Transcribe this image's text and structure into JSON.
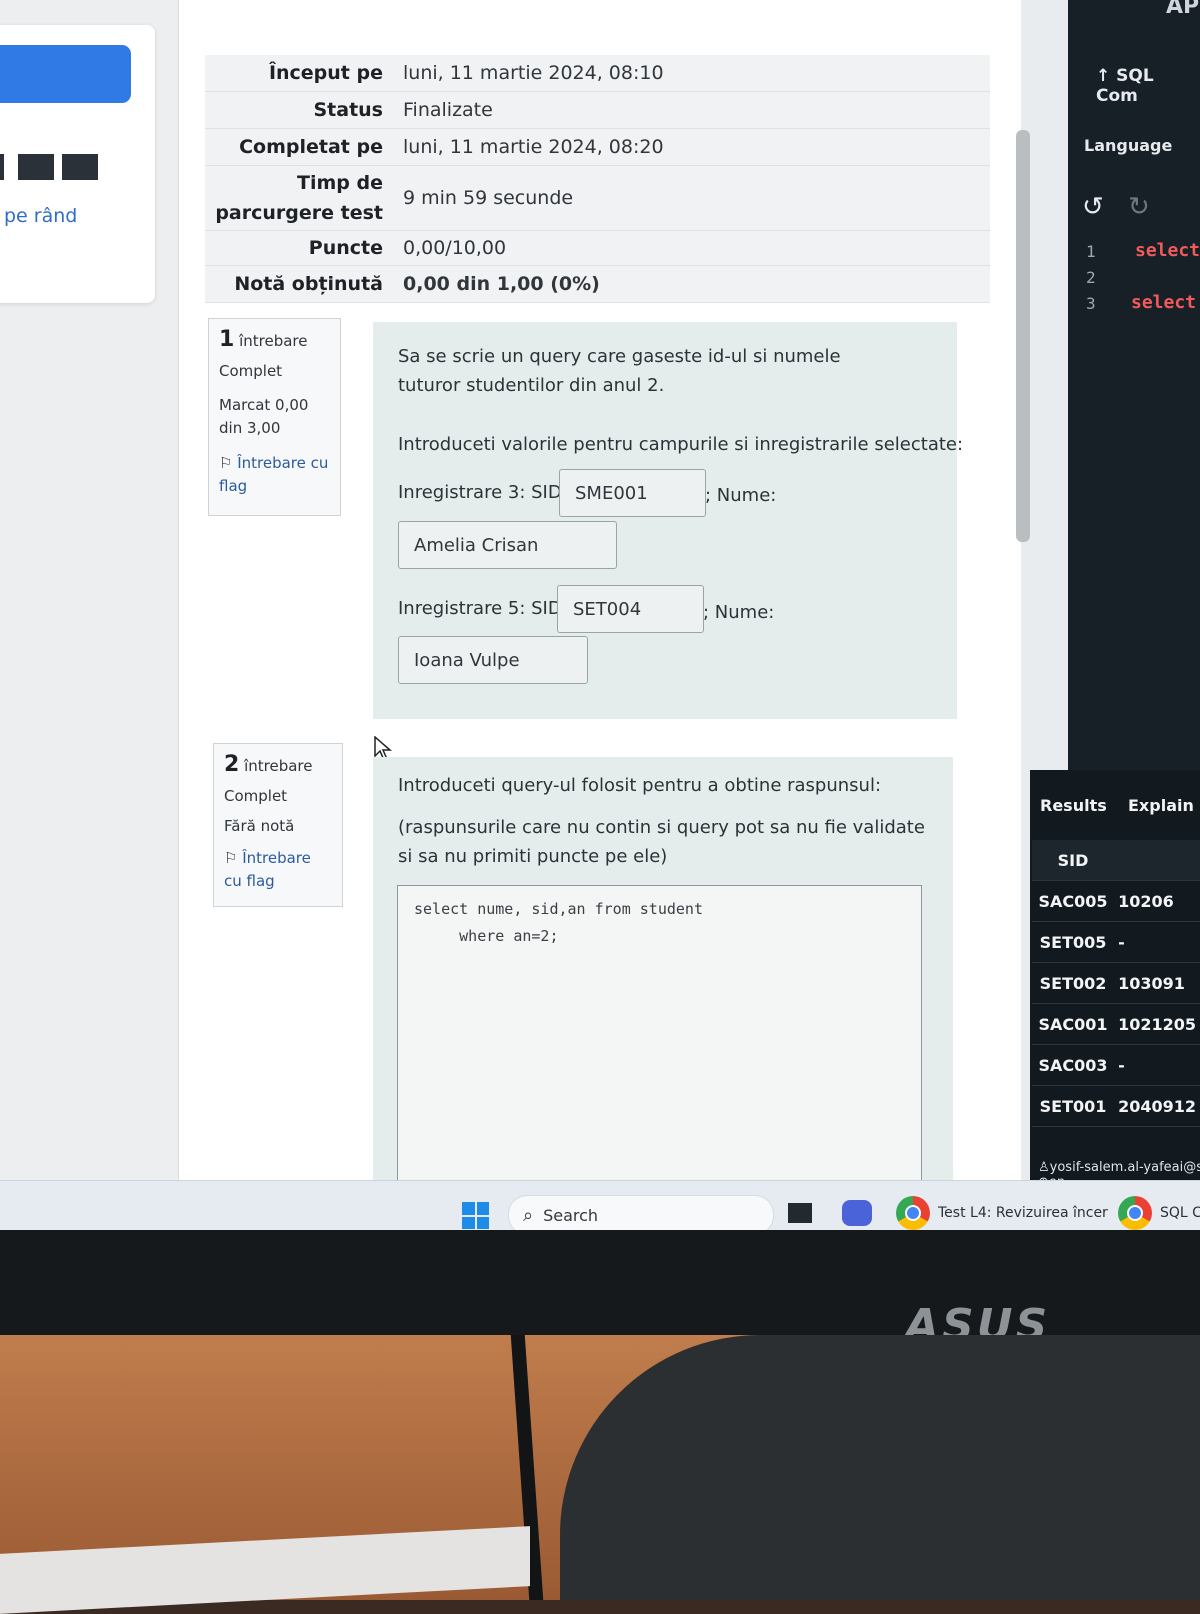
{
  "left": {
    "link_label": "pe rând"
  },
  "summary": [
    {
      "label": "Început pe",
      "value": "luni, 11 martie 2024, 08:10"
    },
    {
      "label": "Status",
      "value": "Finalizate"
    },
    {
      "label": "Completat pe",
      "value": "luni, 11 martie 2024, 08:20"
    },
    {
      "label": "Timp de parcurgere test",
      "value": "9 min 59 secunde"
    },
    {
      "label": "Puncte",
      "value": "0,00/10,00"
    },
    {
      "label": "Notă obținută",
      "value": "0,00 din 1,00 (0%)"
    }
  ],
  "question1": {
    "number": "1",
    "word": "întrebare",
    "state": "Complet",
    "mark": "Marcat 0,00 din 3,00",
    "flag_label": "Întrebare cu flag",
    "text": "Sa se scrie un query care gaseste id-ul si numele tuturor studentilor din anul 2.",
    "instruction": "Introduceti valorile pentru campurile si inregistrarile selectate:",
    "rec3_label": "Inregistrare 3: SID:",
    "rec3_sid": "SME001",
    "rec3_name_label": "; Nume:",
    "rec3_name": "Amelia Crisan",
    "rec5_label": "Inregistrare 5: SID:",
    "rec5_sid": "SET004",
    "rec5_name_label": "; Nume:",
    "rec5_name": "Ioana Vulpe"
  },
  "question2": {
    "number": "2",
    "word": "întrebare",
    "state": "Complet",
    "mark": "Fără notă",
    "flag_label": "Întrebare cu flag",
    "text": "Introduceti query-ul folosit pentru a obtine raspunsul:",
    "note": "(raspunsurile care nu contin si query pot sa nu fie validate si sa nu primiti puncte pe ele)",
    "code": "select nume, sid,an from student\n     where an=2;"
  },
  "sql_panel": {
    "top_label": "AP",
    "title": "SQL Com",
    "language_label": "Language",
    "lines": [
      {
        "n": "1",
        "kw": "select"
      },
      {
        "n": "2",
        "kw": ""
      },
      {
        "n": "3",
        "kw": "select"
      }
    ],
    "results_tab": "Results",
    "explain_tab": "Explain",
    "column": "SID",
    "rows": [
      {
        "sid": "SAC005",
        "val": "10206"
      },
      {
        "sid": "SET005",
        "val": "-"
      },
      {
        "sid": "SET002",
        "val": "103091"
      },
      {
        "sid": "SAC001",
        "val": "1021205"
      },
      {
        "sid": "SAC003",
        "val": "-"
      },
      {
        "sid": "SET001",
        "val": "2040912"
      }
    ],
    "user": "yosif-salem.al-yafeai@stu",
    "lang": "en"
  },
  "taskbar": {
    "search_label": "Search",
    "chrome_tab1": "Test L4: Revizuirea încer",
    "chrome_tab2": "SQL C"
  },
  "monitor": {
    "brand": "ASUS"
  }
}
